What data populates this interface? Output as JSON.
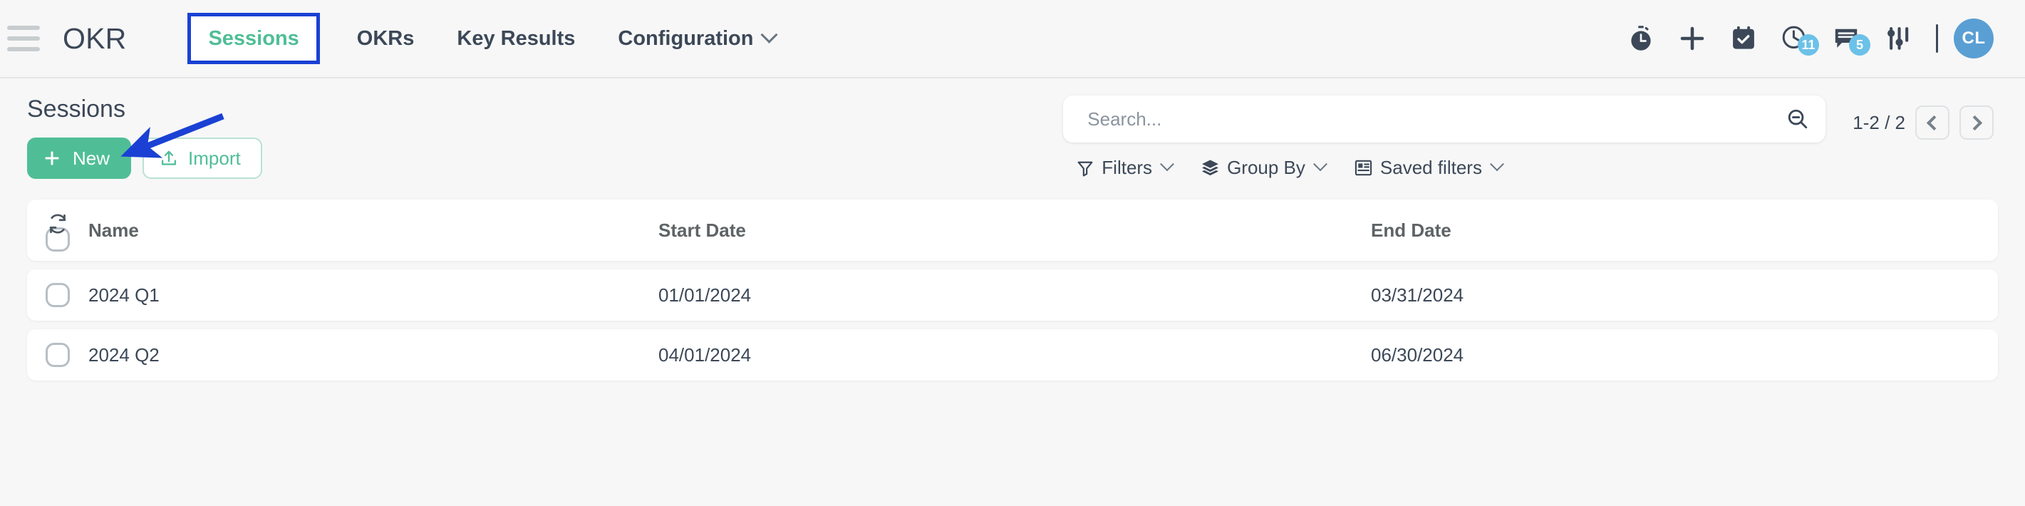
{
  "navbar": {
    "menu_icon": "hamburger-menu-icon",
    "brand": "OKR",
    "items": [
      {
        "label": "Sessions",
        "active": true,
        "has_caret": false
      },
      {
        "label": "OKRs",
        "active": false,
        "has_caret": false
      },
      {
        "label": "Key Results",
        "active": false,
        "has_caret": false
      },
      {
        "label": "Configuration",
        "active": false,
        "has_caret": true
      }
    ],
    "right_icons": [
      {
        "name": "stopwatch-icon",
        "badge": null
      },
      {
        "name": "plus-icon",
        "badge": null
      },
      {
        "name": "calendar-check-icon",
        "badge": null
      },
      {
        "name": "clock-activity-icon",
        "badge": "11"
      },
      {
        "name": "chat-messages-icon",
        "badge": "5"
      },
      {
        "name": "sliders-settings-icon",
        "badge": null
      }
    ],
    "avatar_initials": "CL"
  },
  "controls": {
    "page_title": "Sessions",
    "new_label": "New",
    "import_label": "Import",
    "search": {
      "placeholder": "Search...",
      "value": "",
      "icon": "magnifier-minus-icon"
    },
    "filters": [
      {
        "label": "Filters",
        "icon": "funnel-icon"
      },
      {
        "label": "Group By",
        "icon": "layers-icon"
      },
      {
        "label": "Saved filters",
        "icon": "saved-filters-icon"
      }
    ],
    "pager": {
      "range": "1-2 / 2",
      "prev": "previous-page",
      "next": "next-page"
    }
  },
  "table": {
    "sync_icon": "refresh-sync-icon",
    "columns": [
      "Name",
      "Start Date",
      "End Date"
    ],
    "rows": [
      {
        "name": "2024 Q1",
        "start": "01/01/2024",
        "end": "03/31/2024"
      },
      {
        "name": "2024 Q2",
        "start": "04/01/2024",
        "end": "06/30/2024"
      }
    ]
  },
  "annotation": {
    "type": "arrow",
    "color": "#1a41d4",
    "target": "new-button",
    "highlight_box_target": "Sessions"
  },
  "colors": {
    "accent_green": "#4fbe96",
    "annotation_blue": "#1a41d4",
    "badge_blue": "#6cc1e8",
    "avatar_blue": "#5a9fd4",
    "text_dark": "#3c4858",
    "page_bg": "#f7f7f7"
  }
}
